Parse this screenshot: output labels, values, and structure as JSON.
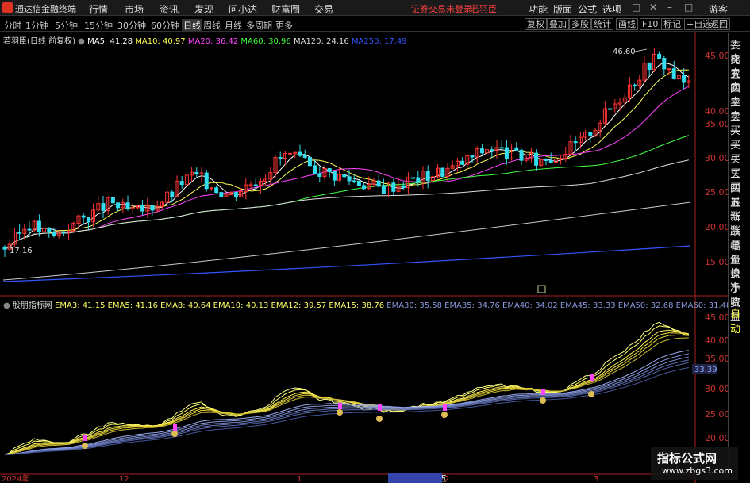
{
  "app": {
    "name": "通达信金融终端",
    "warning": "证券交易未登录",
    "stock_tag": "若羽臣"
  },
  "menus": [
    "行情",
    "市场",
    "资讯",
    "发现",
    "问小达",
    "财富圈",
    "交易"
  ],
  "right_menus": [
    "功能",
    "版面",
    "公式",
    "选项",
    "游客"
  ],
  "toolbar": {
    "periods": [
      "分时",
      "1分钟",
      "5分钟",
      "15分钟",
      "30分钟",
      "60分钟",
      "日线",
      "周线",
      "月线",
      "多周期",
      "更多"
    ],
    "active": "日线",
    "right": [
      "复权",
      "叠加",
      "多股",
      "统计",
      "画线",
      "F10",
      "标记",
      "+自选",
      "返回"
    ]
  },
  "main_legend": {
    "title": "若羽臣(日线 前复权)",
    "items": [
      {
        "label": "MA5: 41.28",
        "color": "#ffffff"
      },
      {
        "label": "MA10: 40.97",
        "color": "#ffff55"
      },
      {
        "label": "MA20: 36.42",
        "color": "#ff44ff"
      },
      {
        "label": "MA60: 30.96",
        "color": "#44ff44"
      },
      {
        "label": "MA120: 24.16",
        "color": "#dddddd"
      },
      {
        "label": "MA250: 17.49",
        "color": "#3355ff"
      }
    ]
  },
  "sub_legend": {
    "title": "股朋指标网",
    "items": [
      {
        "label": "EMA3: 41.15",
        "color": "#ffff66"
      },
      {
        "label": "EMA5: 41.16",
        "color": "#ffff66"
      },
      {
        "label": "EMA8: 40.64",
        "color": "#ffff66"
      },
      {
        "label": "EMA10: 40.13",
        "color": "#ffff66"
      },
      {
        "label": "EMA12: 39.57",
        "color": "#ffff66"
      },
      {
        "label": "EMA15: 38.76",
        "color": "#ffff66"
      },
      {
        "label": "EMA30: 35.58",
        "color": "#8899dd"
      },
      {
        "label": "EMA35: 34.76",
        "color": "#8899dd"
      },
      {
        "label": "EMA40: 34.02",
        "color": "#8899dd"
      },
      {
        "label": "EMA45: 33.33",
        "color": "#8899dd"
      },
      {
        "label": "EMA50: 32.68",
        "color": "#8899dd"
      },
      {
        "label": "EMA60: 31.48",
        "color": "#8899dd"
      }
    ]
  },
  "sidebar": [
    "委比",
    "卖五",
    "卖四",
    "卖三",
    "卖二",
    "卖一",
    "买一",
    "买二",
    "买三",
    "买四",
    "买五",
    "最新",
    "涨跌",
    "涨幅",
    "总量",
    "外盘",
    "换手",
    "净资",
    "收益",
    "自动"
  ],
  "chart_data": {
    "type": "candlestick",
    "y_axis_main": [
      "45.00",
      "40.00",
      "35.00",
      "30.00",
      "25.00",
      "20.00",
      "15.00"
    ],
    "y_axis_sub": [
      "45.00",
      "40.00",
      "35.00",
      "30.00",
      "25.00",
      "20.00"
    ],
    "sub_current_value": "33.39",
    "x_axis": [
      "2024年",
      "12",
      "1",
      "2025/01/17/五",
      "2",
      "3"
    ],
    "annotations": {
      "high": "46.60",
      "low": "17.16"
    }
  },
  "watermark": {
    "line1": "指标公式网",
    "line2": "www.zbgs3.com"
  }
}
